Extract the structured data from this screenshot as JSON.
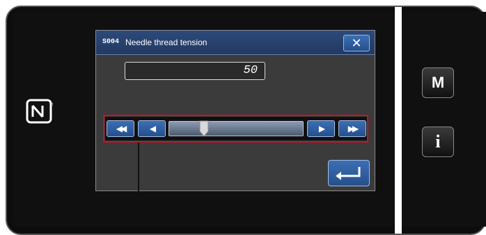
{
  "dialog": {
    "code": "S004",
    "title": "Needle thread tension",
    "close_icon": "close-icon"
  },
  "value": {
    "current": "50",
    "slider_level_fraction": 0.24
  },
  "slider_buttons": {
    "fast_left_icon": "fast-rewind-icon",
    "left_icon": "step-left-icon",
    "right_icon": "step-right-icon",
    "fast_right_icon": "fast-forward-icon"
  },
  "side": {
    "m_label": "M",
    "i_label": "i"
  },
  "icons": {
    "nfc": "nfc-icon",
    "enter": "enter-icon"
  },
  "colors": {
    "accent_blue": "#2f5e9f",
    "highlight_red": "#c8102e"
  }
}
